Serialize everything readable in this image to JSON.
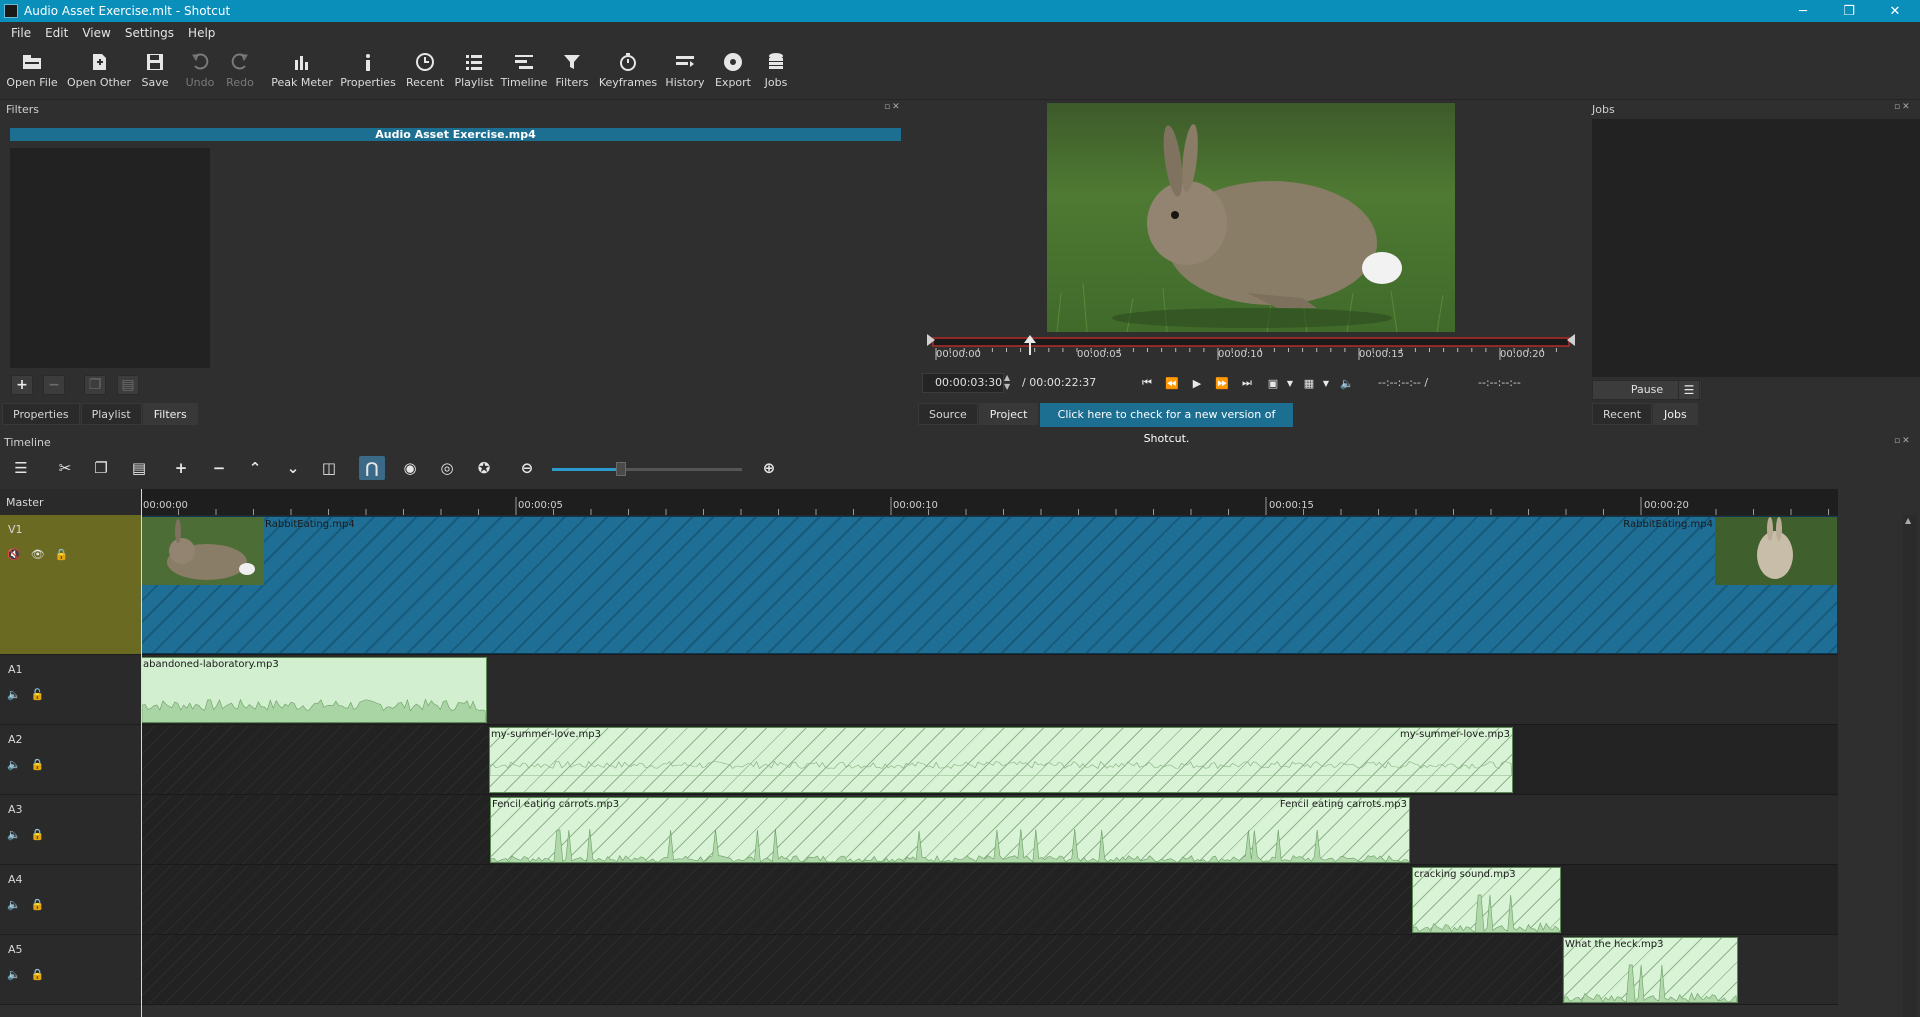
{
  "window": {
    "title": "Audio Asset Exercise.mlt - Shotcut",
    "controls": {
      "minimize": "─",
      "restore": "❐",
      "close": "✕"
    }
  },
  "menu": [
    "File",
    "Edit",
    "View",
    "Settings",
    "Help"
  ],
  "toolbar": {
    "open_file": "Open File",
    "open_other": "Open Other",
    "save": "Save",
    "undo": "Undo",
    "redo": "Redo",
    "peak_meter": "Peak Meter",
    "properties": "Properties",
    "recent": "Recent",
    "playlist": "Playlist",
    "timeline": "Timeline",
    "filters": "Filters",
    "keyframes": "Keyframes",
    "history": "History",
    "export": "Export",
    "jobs": "Jobs"
  },
  "filters_panel": {
    "title": "Filters",
    "clip_name": "Audio Asset Exercise.mp4",
    "tabs": [
      "Properties",
      "Playlist",
      "Filters"
    ],
    "active_tab": "Filters"
  },
  "player": {
    "ruler_labels": [
      "00:00:00",
      "00:00:05",
      "00:00:10",
      "00:00:15",
      "00:00:20"
    ],
    "timecode": "00:00:03:30",
    "duration": "/ 00:00:22:37",
    "in_point": "--:--:--:-- /",
    "out_point": "--:--:--:--",
    "tabs": [
      "Source",
      "Project"
    ],
    "active_tab": "Project",
    "update_message": "Click here to check for a new version of Shotcut."
  },
  "jobs_panel": {
    "title": "Jobs",
    "pause_label": "Pause",
    "tabs": [
      "Recent",
      "Jobs"
    ],
    "active_tab": "Jobs"
  },
  "timeline": {
    "title": "Timeline",
    "master_label": "Master",
    "ruler_labels": [
      "00:00:00",
      "00:00:05",
      "00:00:10",
      "00:00:15",
      "00:00:20"
    ],
    "tracks": [
      {
        "name": "V1"
      },
      {
        "name": "A1"
      },
      {
        "name": "A2"
      },
      {
        "name": "A3"
      },
      {
        "name": "A4"
      },
      {
        "name": "A5"
      }
    ],
    "clips": {
      "v1_start": "RabbitEating.mp4",
      "v1_end": "RabbitEating.mp4",
      "a1": "abandoned-laboratory.mp3",
      "a2_start": "my-summer-love.mp3",
      "a2_end": "my-summer-love.mp3",
      "a3_start": "Fencil eating carrots.mp3",
      "a3_end": "Fencil eating carrots.mp3",
      "a4": "cracking sound.mp3",
      "a5": "What the heck.mp3"
    }
  },
  "colors": {
    "titlebar": "#0a8fbb",
    "accent": "#1d6f91",
    "video_clip": "#1e6e96",
    "audio_clip": "#d8f3d5",
    "selected_track": "#6b6a22"
  }
}
